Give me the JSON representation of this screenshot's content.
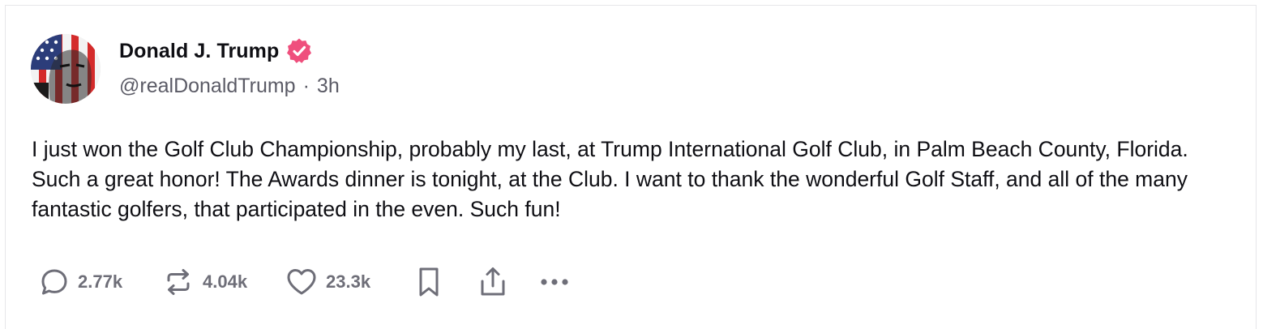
{
  "post": {
    "author_name": "Donald J. Trump",
    "handle": "@realDonaldTrump",
    "separator": "·",
    "time_ago": "3h",
    "text": "I just won the Golf Club Championship, probably my last, at Trump International Golf Club, in Palm Beach County, Florida. Such a great honor! The Awards dinner is tonight, at the Club. I want to thank the wonderful Golf Staff, and all of the many fantastic golfers, that participated in the even. Such fun!"
  },
  "actions": {
    "replies": {
      "icon": "reply-icon",
      "count": "2.77k"
    },
    "retruths": {
      "icon": "retruth-icon",
      "count": "4.04k"
    },
    "likes": {
      "icon": "heart-icon",
      "count": "23.3k"
    },
    "bookmark": {
      "icon": "bookmark-icon"
    },
    "share": {
      "icon": "share-icon"
    },
    "more": {
      "icon": "more-icon"
    }
  },
  "colors": {
    "verified_badge": "#ef4f7d",
    "icon_gray": "#6e6e78",
    "handle_gray": "#5b5b66",
    "text": "#0f0f14"
  }
}
